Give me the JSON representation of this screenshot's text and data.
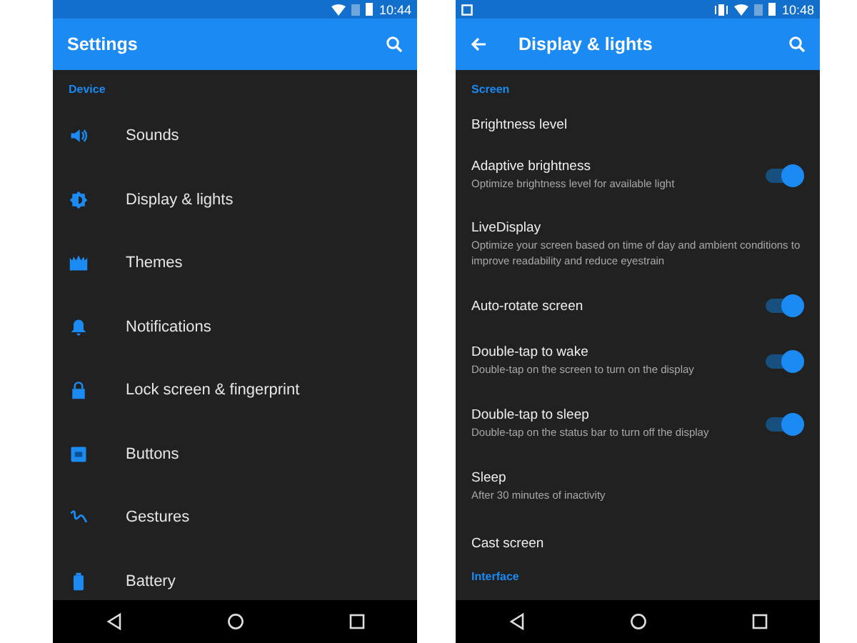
{
  "phones": [
    {
      "status_bar": {
        "time": "10:44",
        "notification_icon": false,
        "vibrate_icon": false
      },
      "app_bar": {
        "title": "Settings",
        "back": false
      },
      "sections": [
        {
          "header": "Device",
          "items": [
            {
              "kind": "sounds",
              "title": "Sounds"
            },
            {
              "kind": "display",
              "title": "Display & lights"
            },
            {
              "kind": "themes",
              "title": "Themes"
            },
            {
              "kind": "notifications",
              "title": "Notifications"
            },
            {
              "kind": "lock",
              "title": "Lock screen & fingerprint"
            },
            {
              "kind": "buttons",
              "title": "Buttons"
            },
            {
              "kind": "gestures",
              "title": "Gestures"
            },
            {
              "kind": "battery",
              "title": "Battery"
            }
          ]
        }
      ]
    },
    {
      "status_bar": {
        "time": "10:48",
        "notification_icon": true,
        "vibrate_icon": true
      },
      "app_bar": {
        "title": "Display & lights",
        "back": true
      },
      "sections": [
        {
          "header": "Screen",
          "items": [
            {
              "kind": "plain",
              "title": "Brightness level"
            },
            {
              "kind": "toggle",
              "title": "Adaptive brightness",
              "subtitle": "Optimize brightness level for available light",
              "on": true
            },
            {
              "kind": "plain",
              "title": "LiveDisplay",
              "subtitle": "Optimize your screen based on time of day and ambient conditions to improve readability and reduce eyestrain"
            },
            {
              "kind": "toggle",
              "title": "Auto-rotate screen",
              "on": true
            },
            {
              "kind": "toggle",
              "title": "Double-tap to wake",
              "subtitle": "Double-tap on the screen to turn on the display",
              "on": true
            },
            {
              "kind": "toggle",
              "title": "Double-tap to sleep",
              "subtitle": "Double-tap on the status bar to turn off the display",
              "on": true
            },
            {
              "kind": "plain",
              "title": "Sleep",
              "subtitle": "After 30 minutes of inactivity"
            },
            {
              "kind": "plain",
              "title": "Cast screen"
            }
          ]
        },
        {
          "header": "Interface"
        }
      ]
    }
  ]
}
